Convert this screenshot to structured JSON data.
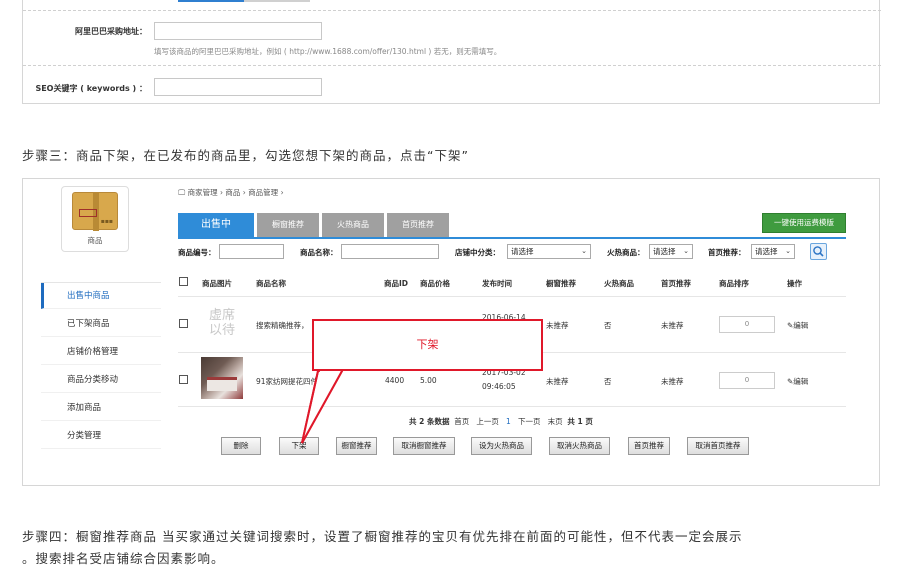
{
  "top_form": {
    "alibaba_label": "阿里巴巴采购地址：",
    "alibaba_hint": "填写该商品的阿里巴巴采购地址，例如 ( http://www.1688.com/offer/130.html ) 若无，则无需填写。",
    "seo_label": "SEO关键字 ( keywords ) ："
  },
  "step3": "步骤三：商品下架，在已发布的商品里，勾选您想下架的商品，点击“下架”",
  "sidebar": {
    "logo_text": "商品",
    "items": [
      {
        "label": "出售中商品"
      },
      {
        "label": "已下架商品"
      },
      {
        "label": "店铺价格管理"
      },
      {
        "label": "商品分类移动"
      },
      {
        "label": "添加商品"
      },
      {
        "label": "分类管理"
      }
    ]
  },
  "breadcrumb": [
    "商家管理",
    "商品",
    "商品管理"
  ],
  "tabs": [
    {
      "label": "出售中"
    },
    {
      "label": "橱窗推荐"
    },
    {
      "label": "火热商品"
    },
    {
      "label": "首页推荐"
    }
  ],
  "template_button": "一键使用运费模版",
  "filters": {
    "code_label": "商品编号：",
    "name_label": "商品名称：",
    "category_label": "店铺中分类：",
    "category_value": "请选择",
    "hot_label": "火热商品：",
    "hot_value": "请选择",
    "home_label": "首页推荐：",
    "home_value": "请选择"
  },
  "table": {
    "headers": [
      "商品图片",
      "商品名称",
      "商品ID",
      "商品价格",
      "发布时间",
      "橱窗推荐",
      "火热商品",
      "首页推荐",
      "商品排序",
      "操作"
    ],
    "rows": [
      {
        "placeholder": "虚席以待",
        "name": "搜索精确推荐，",
        "id": "",
        "price": "",
        "time1": "2016-06-14",
        "time2": "",
        "window": "未推荐",
        "hot": "否",
        "home": "未推荐",
        "rank": "0",
        "edit": "编辑"
      },
      {
        "placeholder": "",
        "name": "91家纺网提花四件套",
        "id": "4400",
        "price": "5.00",
        "time1": "2017-03-02",
        "time2": "09:46:05",
        "window": "未推荐",
        "hot": "否",
        "home": "未推荐",
        "rank": "0",
        "edit": "编辑"
      }
    ]
  },
  "pager": {
    "summary": "共 2 条数据",
    "first": "首页",
    "prev": "上一页",
    "current": "1",
    "next": "下一页",
    "last": "末页",
    "total": "共 1 页"
  },
  "actions": [
    "删除",
    "下架",
    "橱窗推荐",
    "取消橱窗推荐",
    "设为火热商品",
    "取消火热商品",
    "首页推荐",
    "取消首页推荐"
  ],
  "callout": "下架",
  "step4_line1": "步骤四：橱窗推荐商品 当买家通过关键词搜索时，设置了橱窗推荐的宝贝有优先排在前面的可能性，但不代表一定会展示",
  "step4_line2": "。搜索排名受店铺综合因素影响。",
  "colors": {
    "accent": "#2f8cd8",
    "callout": "#e0182a",
    "green": "#3f9b3f"
  }
}
